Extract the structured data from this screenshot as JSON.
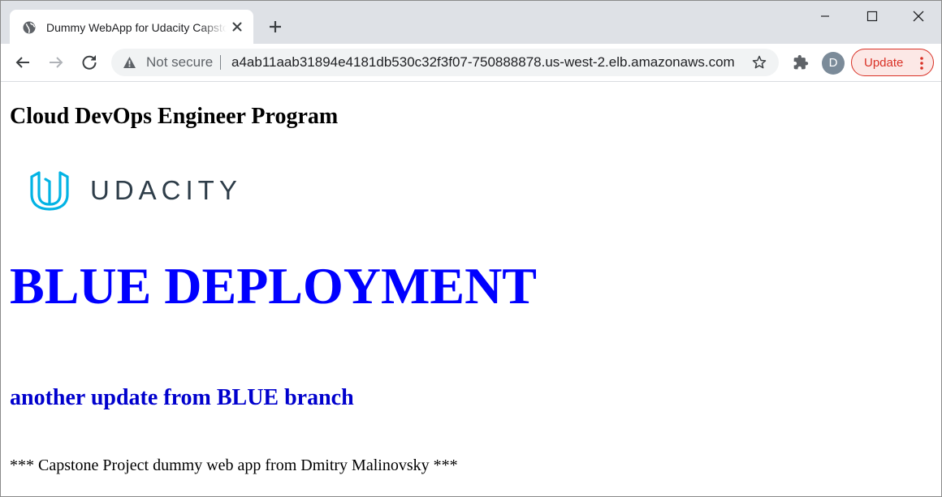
{
  "browser": {
    "tab": {
      "title": "Dummy WebApp for Udacity Capstone Project",
      "favicon": "globe-icon"
    },
    "address_bar": {
      "security_label": "Not secure",
      "url": "a4ab11aab31894e4181db530c32f3f07-750888878.us-west-2.elb.amazonaws.com"
    },
    "profile_initial": "D",
    "update_label": "Update",
    "icons": [
      "back-arrow-icon",
      "forward-arrow-icon",
      "reload-icon",
      "warning-icon",
      "star-icon",
      "puzzle-icon",
      "more-vert-icon",
      "minimize-icon",
      "maximize-icon",
      "close-icon",
      "plus-icon"
    ]
  },
  "page": {
    "title": "Cloud DevOps Engineer Program",
    "logo_text": "UDACITY",
    "deployment_heading": "BLUE DEPLOYMENT",
    "update_message": "another update from BLUE branch",
    "footer": "*** Capstone Project dummy web app from Dmitry Malinovsky ***"
  },
  "colors": {
    "deployment_heading": "#0000ff",
    "update_message": "#0000cd",
    "logo_mark": "#02b3e4",
    "logo_text": "#2e3d49",
    "update_button_border": "#d93025",
    "update_button_bg": "#fce8e6"
  }
}
